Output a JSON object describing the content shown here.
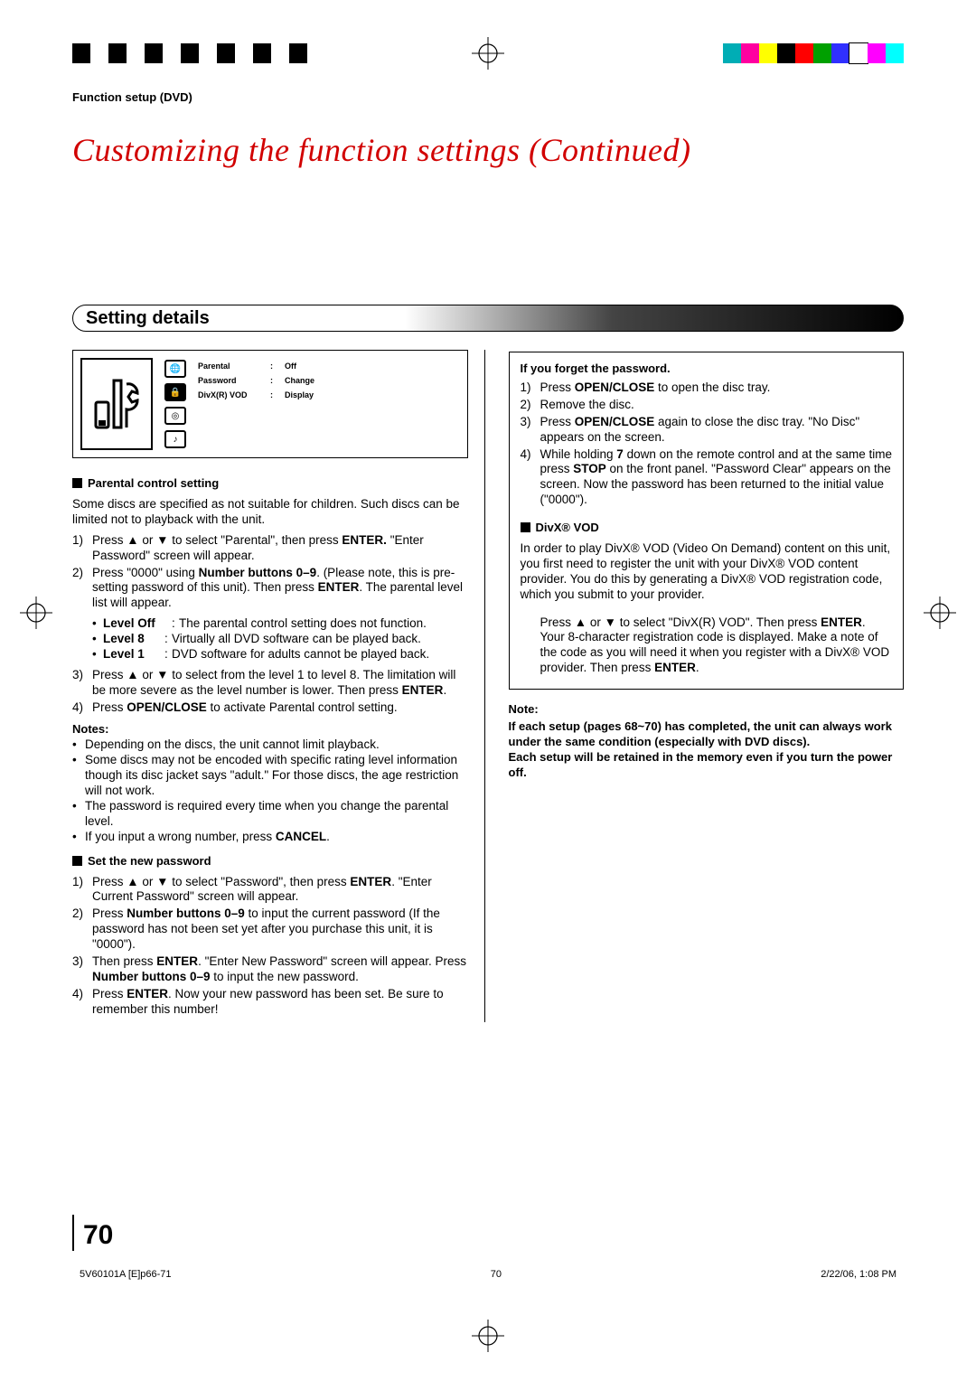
{
  "color_bar": [
    "#00adb5",
    "#ff00a0",
    "#ffff00",
    "#000000",
    "#ff0000",
    "#00a000",
    "#3030ff",
    "#ffffff",
    "#ff00ff",
    "#00ffff"
  ],
  "header": {
    "section": "Function setup (DVD)",
    "title": "Customizing the function settings (Continued)"
  },
  "details_heading": "Setting details",
  "diagram": {
    "items": [
      {
        "k": "Parental",
        "v": "Off"
      },
      {
        "k": "Password",
        "v": "Change"
      },
      {
        "k": "DivX(R) VOD",
        "v": "Display"
      }
    ]
  },
  "left": {
    "parental_head": "Parental control setting",
    "parental_intro": "Some discs are specified as not suitable for children. Such discs can be limited not to playback with the unit.",
    "parental_steps": [
      {
        "n": "1)",
        "t_html": "Press ▲ or ▼ to select \"Parental\", then press <b>ENTER.</b> \"Enter Password\" screen will appear."
      },
      {
        "n": "2)",
        "t_html": "Press \"0000\" using <b>Number buttons 0–9</b>. (Please note, this is pre-setting password of this unit). Then press <b>ENTER</b>. The parental level list will appear."
      }
    ],
    "level_rows": [
      {
        "label": "Level Off",
        "text": "The parental control setting does not function."
      },
      {
        "label": "Level 8",
        "text": "Virtually all DVD software can be played back."
      },
      {
        "label": "Level 1",
        "text": "DVD software for adults cannot be played back."
      }
    ],
    "parental_steps2": [
      {
        "n": "3)",
        "t_html": "Press ▲ or ▼ to select from the level 1 to level 8. The limitation will be more severe as the level number is lower. Then press <b>ENTER</b>."
      },
      {
        "n": "4)",
        "t_html": "Press <b>OPEN/CLOSE</b> to activate Parental control setting."
      }
    ],
    "notes_head": "Notes:",
    "notes": [
      "Depending on the discs, the unit cannot limit playback.",
      "Some discs may not be encoded with specific rating level information though its disc jacket says \"adult.\" For those discs, the age restriction will not work.",
      "The password is required every time when you change the parental level.",
      "If you input a wrong number, press <b>CANCEL</b>."
    ],
    "set_pw_head": "Set the new password",
    "set_pw_steps": [
      {
        "n": "1)",
        "t_html": "Press ▲ or ▼ to select \"Password\", then press <b>ENTER</b>. \"Enter Current Password\" screen will appear."
      },
      {
        "n": "2)",
        "t_html": "Press <b>Number buttons 0–9</b> to input the current password (If the password has not been set yet after you purchase this unit, it is \"0000\")."
      },
      {
        "n": "3)",
        "t_html": "Then press <b>ENTER</b>. \"Enter New Password\" screen will appear. Press <b>Number buttons 0–9</b> to input the new password."
      },
      {
        "n": "4)",
        "t_html": "Press <b>ENTER</b>. Now your new password has been set. Be sure to remember this number!"
      }
    ]
  },
  "right": {
    "forget_head": "If you forget the password.",
    "forget_steps": [
      {
        "n": "1)",
        "t_html": "Press <b>OPEN/CLOSE</b> to open the disc tray."
      },
      {
        "n": "2)",
        "t_html": "Remove the disc."
      },
      {
        "n": "3)",
        "t_html": "Press <b>OPEN/CLOSE</b> again to close the disc tray. \"No Disc\" appears on the screen."
      },
      {
        "n": "4)",
        "t_html": "While holding <b>7</b> down on the remote control and at the same time press <b>STOP</b> on the front panel. \"Password Clear\" appears on the screen. Now the password has been returned to the initial value (\"0000\")."
      }
    ],
    "divx_head": "DivX® VOD",
    "divx_intro": "In order to play DivX® VOD (Video On Demand) content on this unit, you first need to register the unit with your DivX® VOD content provider. You do this by generating a DivX® VOD registration code, which you submit to your provider.",
    "divx_step_html": "Press ▲ or ▼ to select \"DivX(R) VOD\". Then press <b>ENTER</b>. Your 8-character registration code is displayed. Make a note of the code as you will need it when you register with a DivX® VOD provider. Then press <b>ENTER</b>.",
    "note_head": "Note:",
    "note_lines": [
      "If each setup (pages 68~70) has completed, the unit can always work under the same condition (especially with DVD discs).",
      "Each setup will be retained in the memory even if you turn the power off."
    ]
  },
  "page_number": "70",
  "footer": {
    "left": "5V60101A [E]p66-71",
    "center": "70",
    "right": "2/22/06, 1:08 PM"
  }
}
